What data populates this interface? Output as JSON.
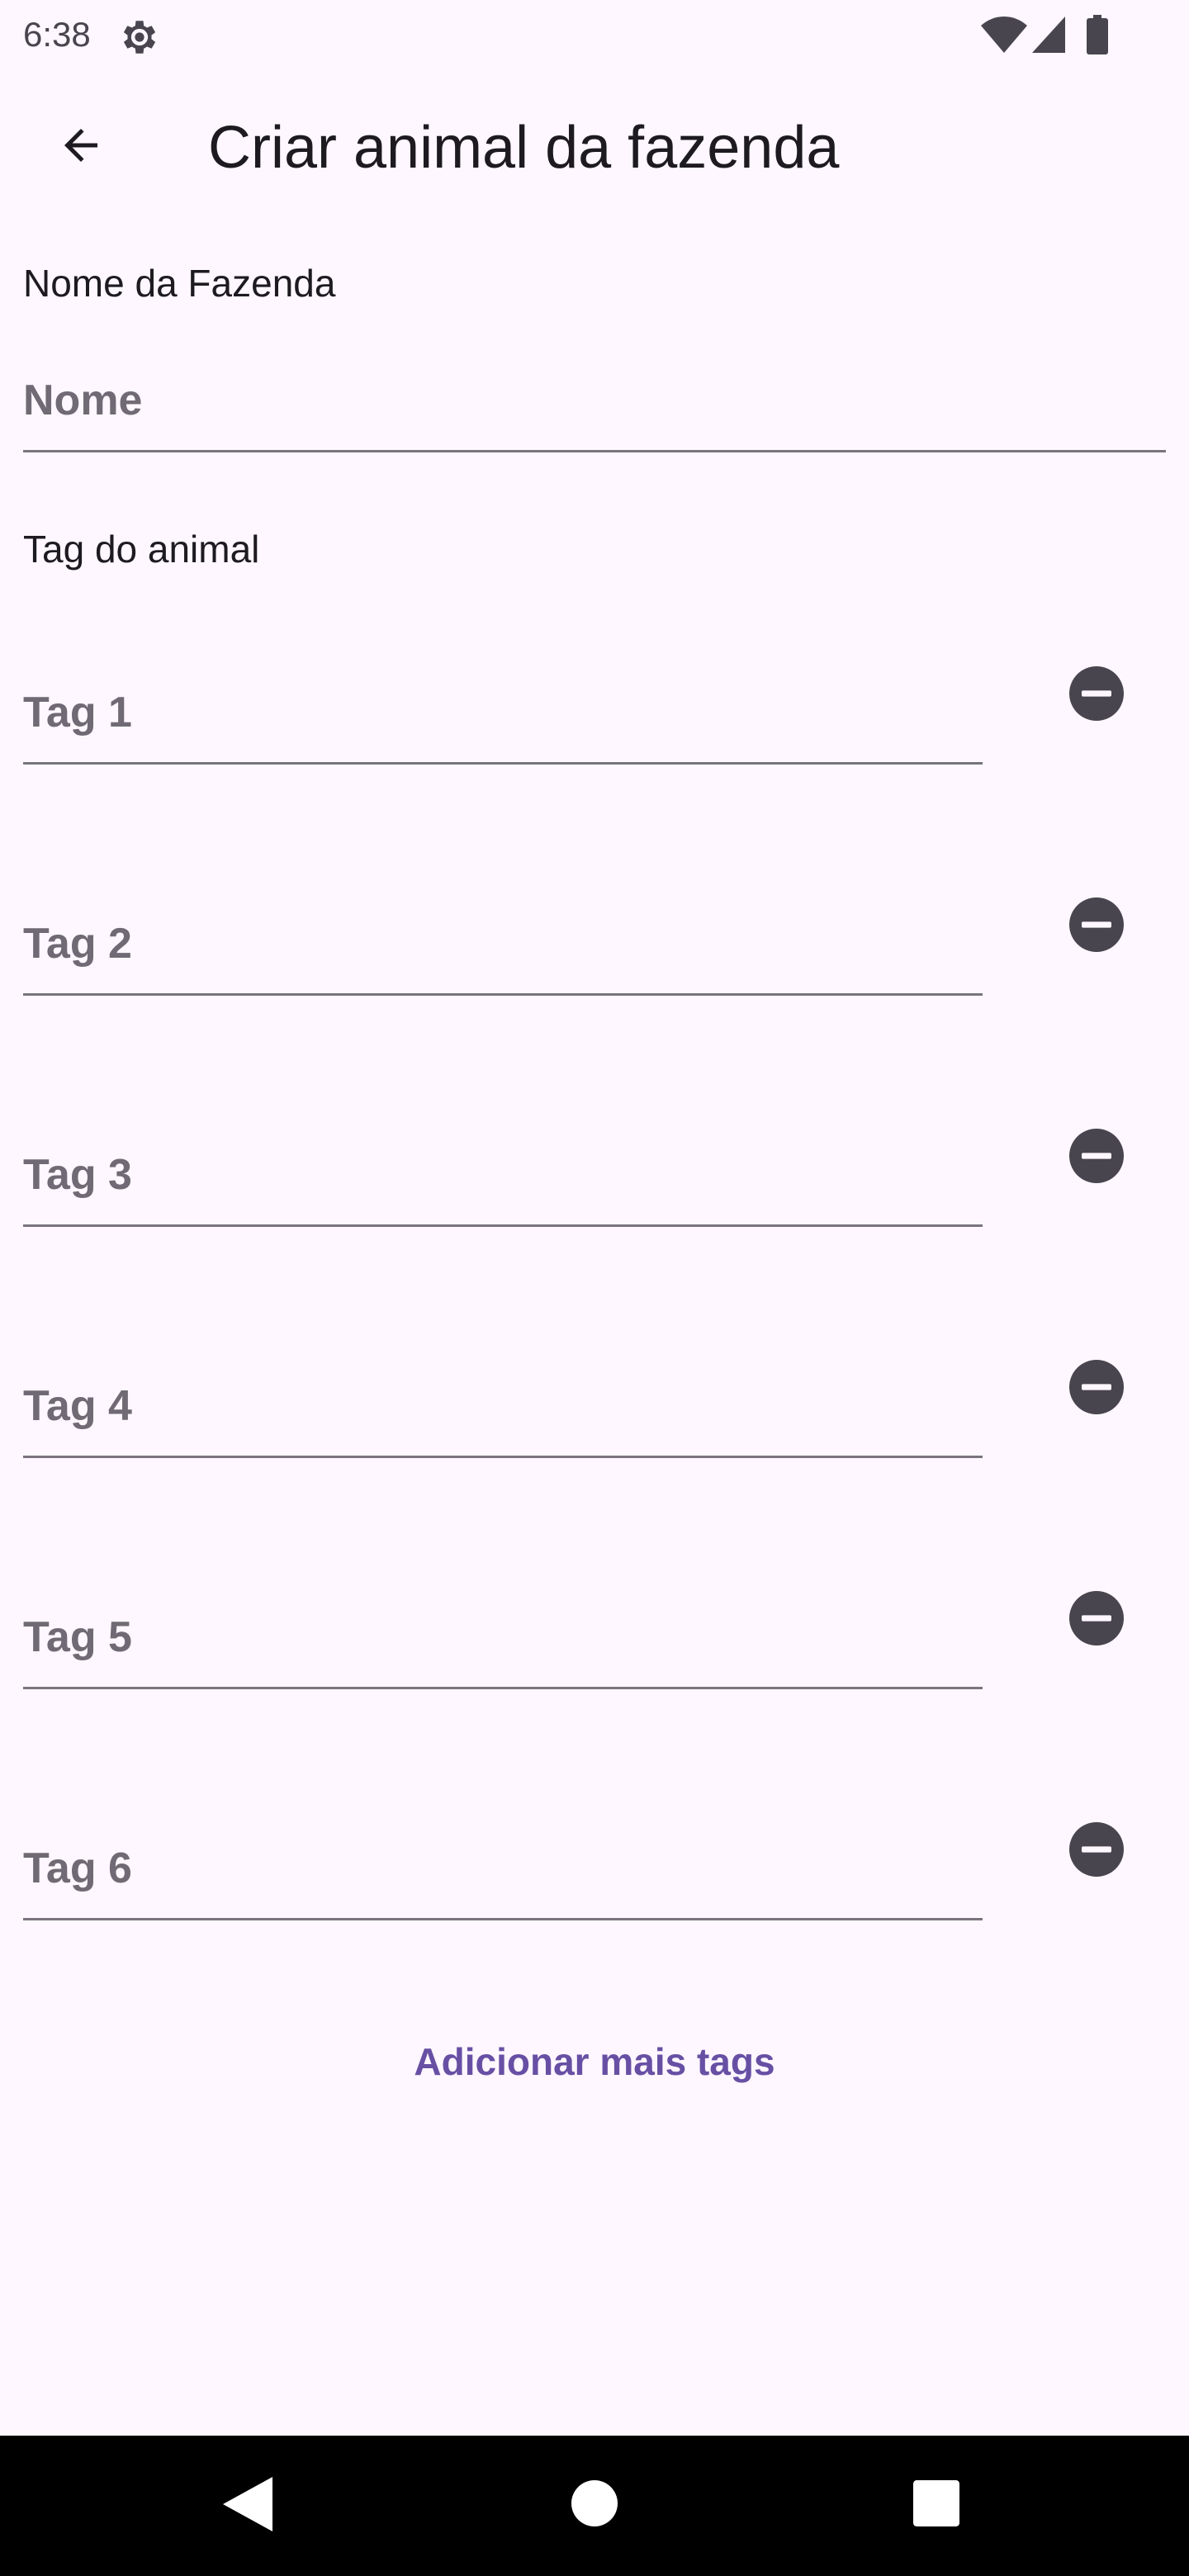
{
  "status_bar": {
    "time": "6:38",
    "icons": [
      "gear-icon",
      "wifi-icon",
      "signal-icon",
      "battery-icon"
    ]
  },
  "app_bar": {
    "title": "Criar animal da fazenda",
    "back_icon": "arrow-back-icon"
  },
  "farm_section": {
    "label": "Nome da Fazenda",
    "name_placeholder": "Nome",
    "name_value": ""
  },
  "tag_section": {
    "label": "Tag do animal",
    "tags": [
      {
        "placeholder": "Tag 1",
        "value": ""
      },
      {
        "placeholder": "Tag 2",
        "value": ""
      },
      {
        "placeholder": "Tag 3",
        "value": ""
      },
      {
        "placeholder": "Tag 4",
        "value": ""
      },
      {
        "placeholder": "Tag 5",
        "value": ""
      },
      {
        "placeholder": "Tag 6",
        "value": ""
      }
    ],
    "remove_icon": "remove-circle-icon"
  },
  "add_more_label": "Adicionar mais tags",
  "colors": {
    "background": "#FEF7FF",
    "accent": "#6750A4",
    "icon_dark": "#49454F",
    "nav_bar": "#000000"
  },
  "nav_bar": {
    "icons": [
      "nav-back-icon",
      "nav-home-icon",
      "nav-recents-icon"
    ]
  }
}
